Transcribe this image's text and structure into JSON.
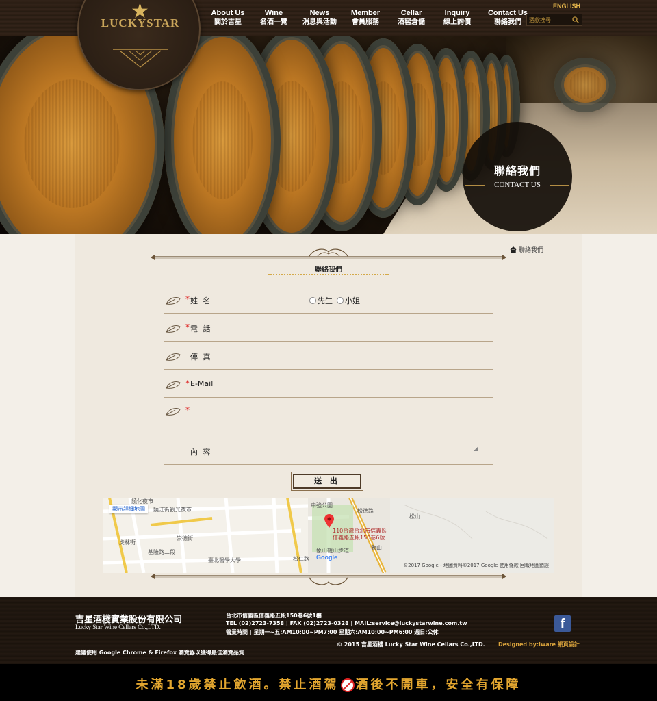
{
  "brand": {
    "logo_text": "LUCKYSTAR"
  },
  "nav": {
    "items": [
      {
        "en": "About Us",
        "zh": "關於吉星"
      },
      {
        "en": "Wine",
        "zh": "名酒一覽"
      },
      {
        "en": "News",
        "zh": "消息與活動"
      },
      {
        "en": "Member",
        "zh": "會員服務"
      },
      {
        "en": "Cellar",
        "zh": "酒窖倉儲"
      },
      {
        "en": "Inquiry",
        "zh": "線上詢價"
      },
      {
        "en": "Contact Us",
        "zh": "聯絡我們"
      }
    ],
    "english_label": "ENGLISH",
    "search_placeholder": "酒款搜尋"
  },
  "hero": {
    "title_zh": "聯絡我們",
    "title_en": "CONTACT US"
  },
  "breadcrumb": {
    "label": "聯絡我們"
  },
  "form": {
    "title": "聯絡我們",
    "fields": [
      {
        "label": "姓 名",
        "required": true
      },
      {
        "label": "電 話",
        "required": true
      },
      {
        "label": "傳 真",
        "required": false
      },
      {
        "label": "E-Mail",
        "required": true
      },
      {
        "label": "內 容",
        "required": true
      }
    ],
    "radio_options": [
      "先生",
      "小姐"
    ],
    "submit_label": "送 出"
  },
  "map": {
    "detail_link": "顯示詳細地圖",
    "labels": [
      "饒化夜市",
      "饒江街觀光夜市",
      "中強公園",
      "松德路",
      "松山",
      "象山親山步道",
      "象山",
      "臺北醫學大學",
      "基隆路二段",
      "崇德街",
      "虎林街",
      "松仁路"
    ],
    "pin_address_1": "110台灣台北市信義區",
    "pin_address_2": "信義路五段150巷6號",
    "footer": "©2017 Google - 地圖資料©2017 Google   使用條款   回報地圖錯誤",
    "google_logo": "Google"
  },
  "footer": {
    "company_zh": "吉星酒棧實業股份有限公司",
    "company_en": "Lucky Star Wine Cellars Co.,LTD.",
    "address": "台北市信義區信義路五段150巷6號1樓",
    "contact": "TEL (02)2723-7358 | FAX (02)2723-0328 | MAIL:service@luckystarwine.com.tw",
    "hours": "營業時間 | 星期一~五:AM10:00~PM7:00   星期六:AM10:00~PM6:00   週日:公休",
    "copyright": "© 2015 吉星酒棧 Lucky Star Wine Cellars Co.,LTD.",
    "designed_by": "Designed by:iware 網頁設計",
    "browser_note": "建議使用 Google Chrome & Firefox 瀏覽器以獲得最佳瀏覽品質",
    "facebook": "f"
  },
  "warning": {
    "part1": "未滿18歲禁止飲酒。禁止酒駕",
    "part2": "酒後不開車，安全有保障"
  }
}
